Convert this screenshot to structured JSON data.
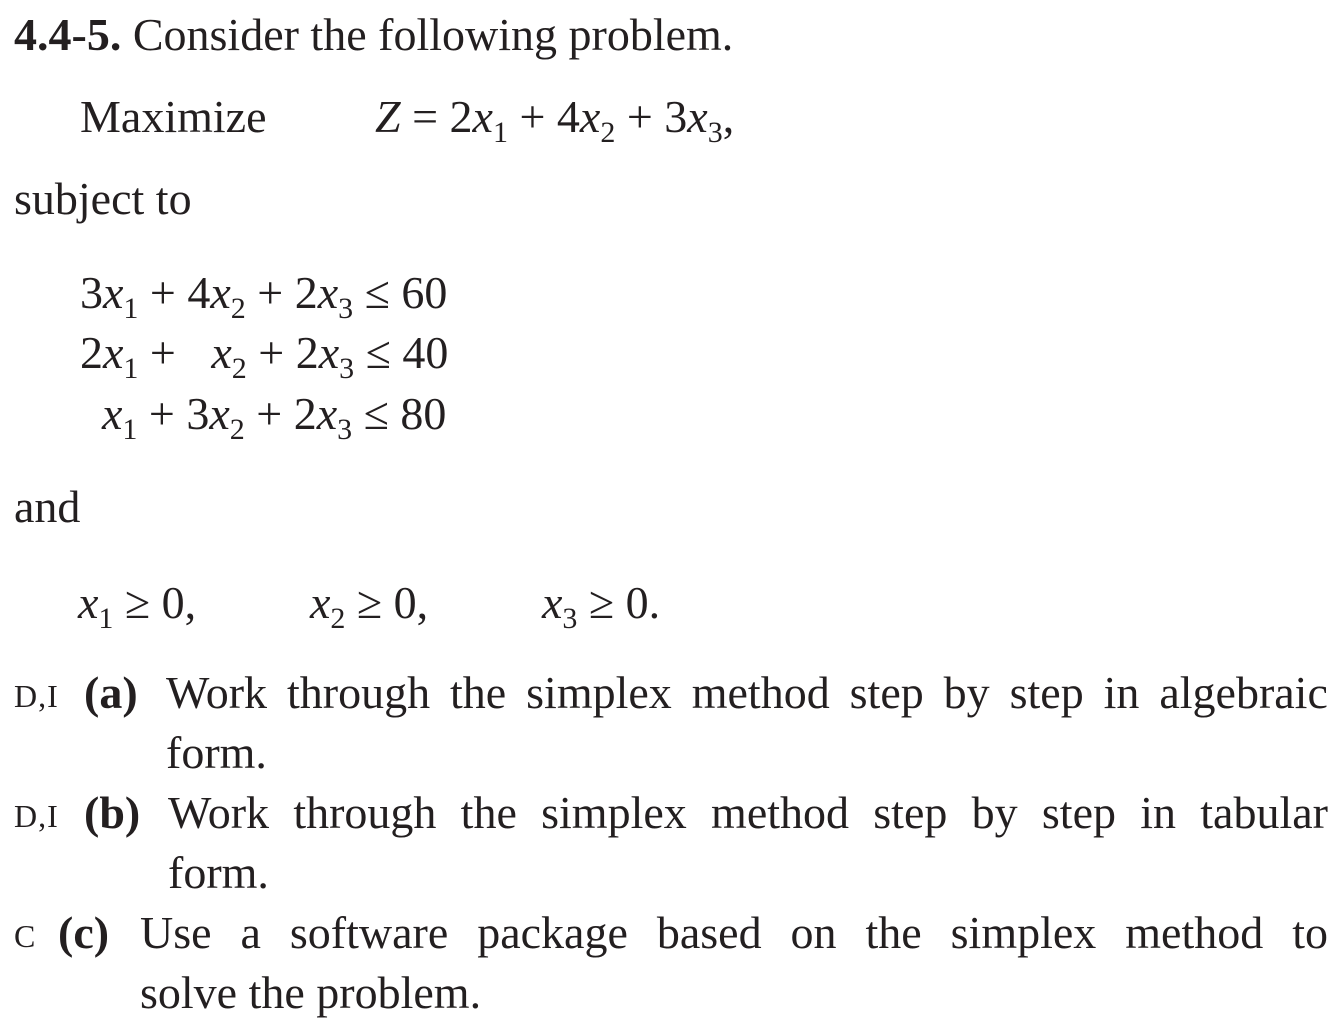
{
  "problem": {
    "number": "4.4-5.",
    "intro": "Consider the following problem.",
    "objective_label": "Maximize",
    "objective": {
      "lhs": "Z",
      "eq": "=",
      "terms": [
        "2",
        "4",
        "3"
      ]
    },
    "subject_to": "subject to",
    "constraints": [
      {
        "c1": "3",
        "c2": "4",
        "c3": "2",
        "rel": "≤",
        "rhs": "60"
      },
      {
        "c1": "2",
        "c2": "",
        "c3": "2",
        "rel": "≤",
        "rhs": "40"
      },
      {
        "c1": "",
        "c2": "3",
        "c3": "2",
        "rel": "≤",
        "rhs": "80"
      }
    ],
    "and": "and",
    "nonneg": [
      {
        "rel": "≥",
        "rhs": "0,"
      },
      {
        "rel": "≥",
        "rhs": "0,"
      },
      {
        "rel": "≥",
        "rhs": "0."
      }
    ],
    "parts": [
      {
        "tag": "D,I",
        "label": "(a)",
        "line1": [
          "Work",
          "through",
          "the",
          "simplex",
          "method",
          "step",
          "by",
          "step",
          "in",
          "algebraic"
        ],
        "line2": "form."
      },
      {
        "tag": "D,I",
        "label": "(b)",
        "line1": [
          "Work",
          "through",
          "the",
          "simplex",
          "method",
          "step",
          "by",
          "step",
          "in",
          "tabular"
        ],
        "line2": "form."
      },
      {
        "tag": "C",
        "label": "(c)",
        "line1": [
          "Use",
          "a",
          "software",
          "package",
          "based",
          "on",
          "the",
          "simplex",
          "method",
          "to"
        ],
        "line2": "solve the problem."
      }
    ]
  }
}
